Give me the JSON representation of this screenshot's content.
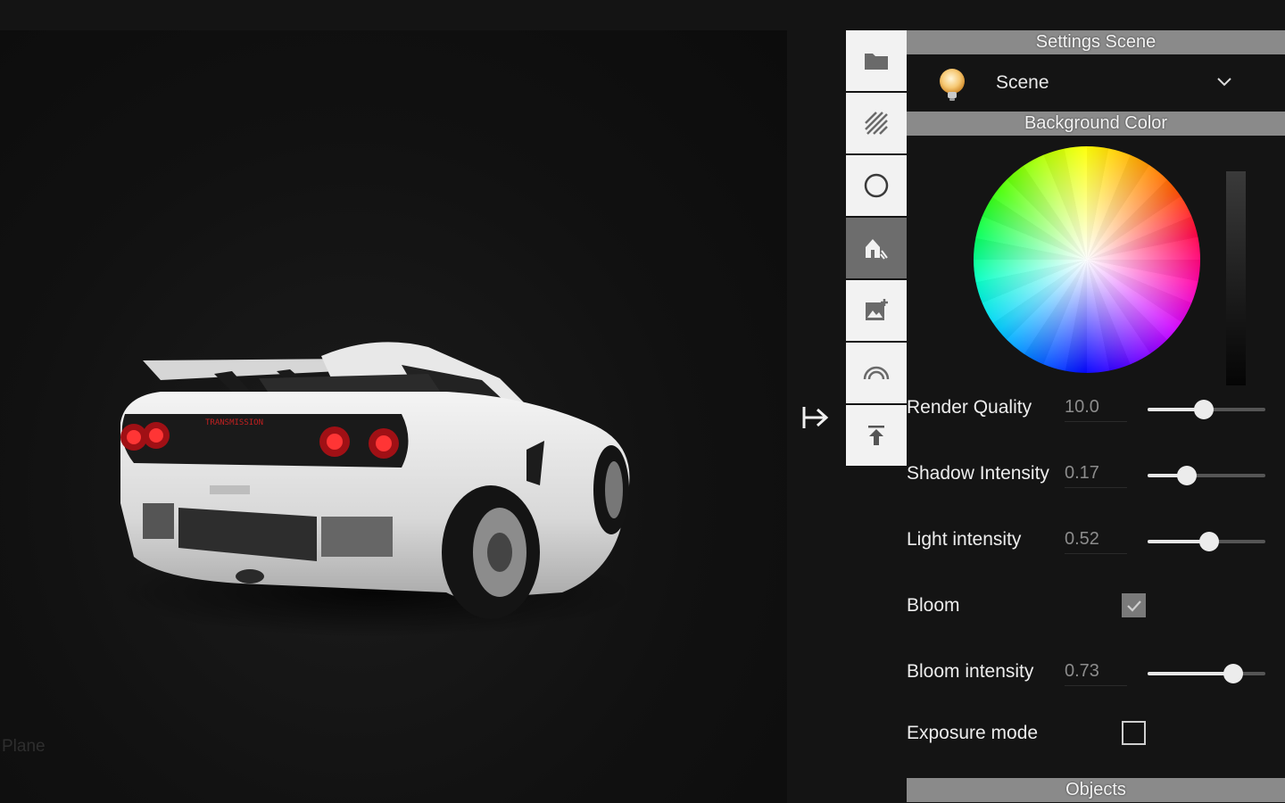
{
  "viewport": {
    "object_label": "Plane"
  },
  "toolbar": {
    "items": [
      {
        "name": "folder-icon",
        "active": false
      },
      {
        "name": "texture-hatch-icon",
        "active": false
      },
      {
        "name": "circle-material-icon",
        "active": false
      },
      {
        "name": "scene-light-icon",
        "active": true
      },
      {
        "name": "image-add-icon",
        "active": false
      },
      {
        "name": "environment-arc-icon",
        "active": false
      },
      {
        "name": "upload-icon",
        "active": false
      }
    ]
  },
  "panel": {
    "settings_header": "Settings Scene",
    "scene_selector": {
      "label": "Scene"
    },
    "background_header": "Background Color",
    "render_quality": {
      "label": "Render Quality",
      "value": "10.0",
      "fraction": 0.48
    },
    "shadow_intensity": {
      "label": "Shadow Intensity",
      "value": "0.17",
      "fraction": 0.33
    },
    "light_intensity": {
      "label": "Light intensity",
      "value": "0.52",
      "fraction": 0.52
    },
    "bloom": {
      "label": "Bloom",
      "checked": true
    },
    "bloom_intensity": {
      "label": "Bloom intensity",
      "value": "0.73",
      "fraction": 0.73
    },
    "exposure_mode": {
      "label": "Exposure mode",
      "checked": false
    },
    "objects_header": "Objects"
  },
  "colors": {
    "panel_header_bg": "#8a8a8a",
    "toolbar_bg": "#f2f2f2",
    "toolbar_active_bg": "#6d6d6d",
    "car_tail_light": "#e0101a"
  }
}
